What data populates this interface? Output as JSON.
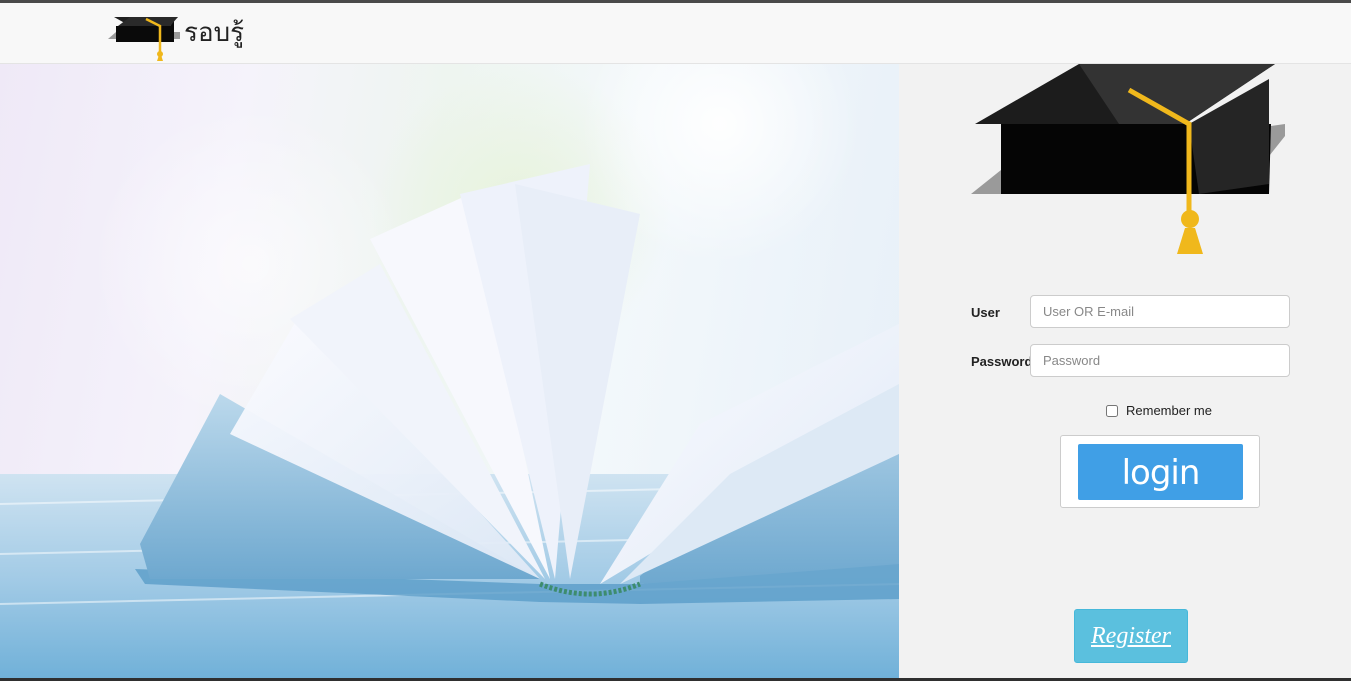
{
  "brand": {
    "name": "รอบรู้",
    "icon": "graduation-cap-icon"
  },
  "hero": {
    "image": "open-book-photo"
  },
  "login_form": {
    "user_label": "User",
    "user_placeholder": "User OR E-mail",
    "user_value": "",
    "password_label": "Password",
    "password_placeholder": "Password",
    "password_value": "",
    "remember_label": "Remember me",
    "remember_checked": false,
    "login_button": "login",
    "register_button": "Register"
  },
  "colors": {
    "login_button": "#409fe6",
    "register_button": "#5bc0de",
    "panel_bg": "#f2f2f2",
    "cap_tassel": "#f0b81c"
  }
}
